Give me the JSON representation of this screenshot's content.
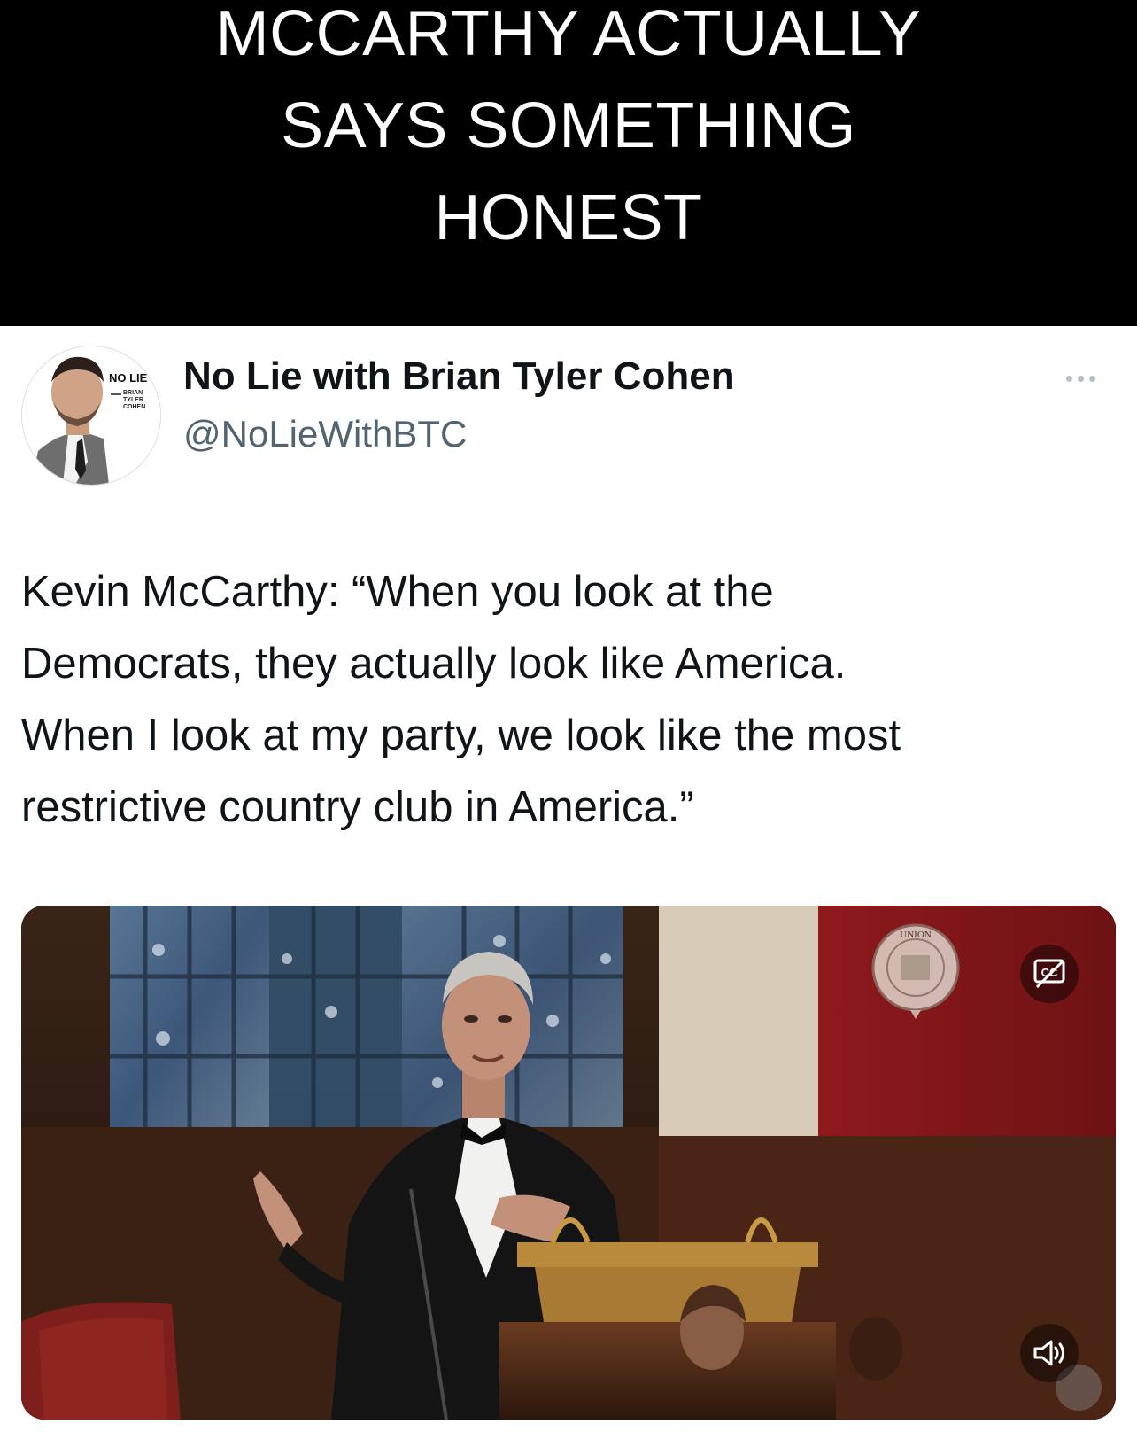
{
  "banner": {
    "lines": [
      "MCCARTHY ACTUALLY",
      "SAYS SOMETHING",
      "HONEST"
    ]
  },
  "post": {
    "avatar_badge": {
      "brand": "NO LIE",
      "names": [
        "BRIAN",
        "TYLER",
        "COHEN"
      ]
    },
    "display_name": "No Lie with Brian Tyler Cohen",
    "handle": "@NoLieWithBTC",
    "text_lines": [
      "Kevin McCarthy: “When you look at the",
      "Democrats, they actually look like America.",
      "When I look at my party, we look like the most",
      "restrictive country club in America.”"
    ]
  },
  "video": {
    "watermark_seal_text": "UNION",
    "controls": {
      "captions_icon": "closed-captions-icon",
      "mute_icon": "speaker-muted-icon"
    }
  },
  "colors": {
    "banner_bg": "#000000",
    "banner_text": "#ffffff",
    "name": "#0f1419",
    "handle": "#536471"
  }
}
